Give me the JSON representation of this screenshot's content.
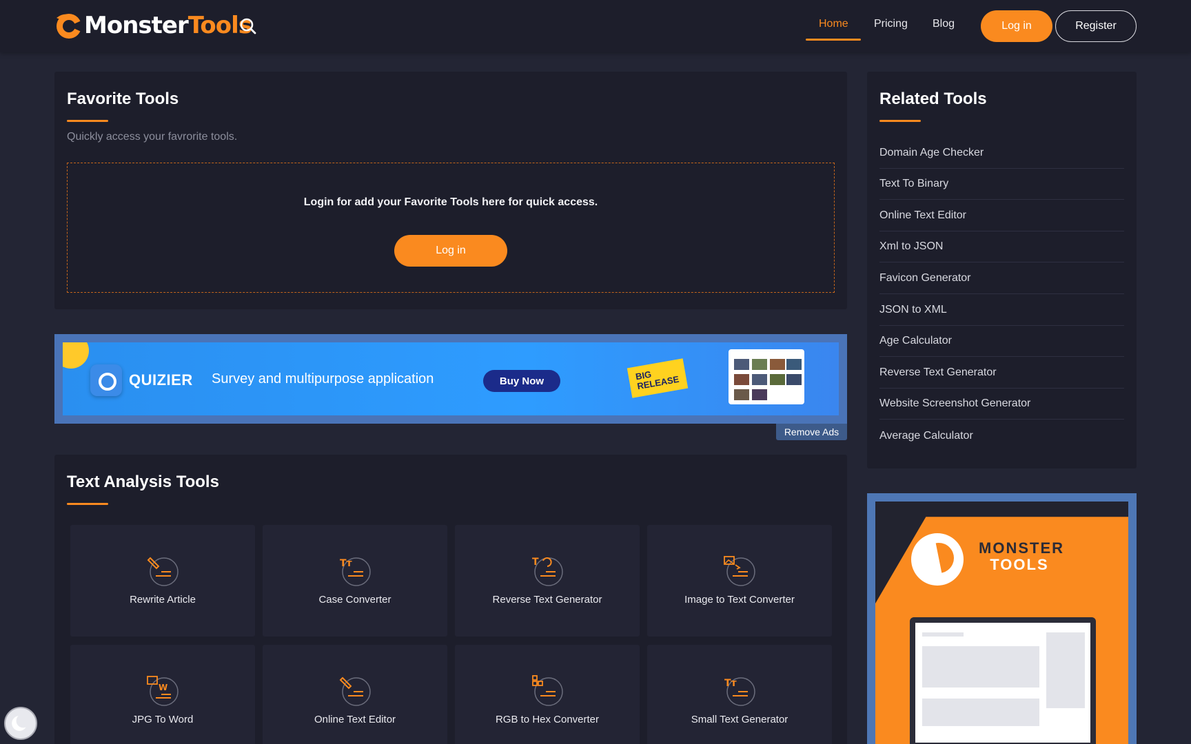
{
  "brand": {
    "logo_word_1": "Monster",
    "logo_word_2": "Tools",
    "accent": "#fa8a1f",
    "background": "#232534",
    "panel": "#1d1e2b"
  },
  "header": {
    "nav": [
      {
        "label": "Home",
        "active": true
      },
      {
        "label": "Pricing",
        "active": false
      },
      {
        "label": "Blog",
        "active": false
      }
    ],
    "login_label": "Log in",
    "register_label": "Register",
    "search_icon": "search-icon"
  },
  "favorites": {
    "title": "Favorite Tools",
    "subtitle": "Quickly access your favrorite tools.",
    "message": "Login for add your Favorite Tools here for quick access.",
    "login_label": "Log in"
  },
  "ad": {
    "brand": "QUIZIER",
    "tagline": "Survey and multipurpose application",
    "cta": "Buy Now",
    "badge": "BIG RELEASE",
    "remove_label": "Remove Ads"
  },
  "text_tools": {
    "title": "Text Analysis Tools",
    "items": [
      {
        "label": "Rewrite Article",
        "icon": "pencil-lines-icon"
      },
      {
        "label": "Case Converter",
        "icon": "text-case-icon"
      },
      {
        "label": "Reverse Text Generator",
        "icon": "text-reverse-icon"
      },
      {
        "label": "Image to Text Converter",
        "icon": "image-text-icon"
      },
      {
        "label": "JPG To Word",
        "icon": "image-word-icon"
      },
      {
        "label": "Online Text Editor",
        "icon": "pencil-lines-icon"
      },
      {
        "label": "RGB to Hex Converter",
        "icon": "color-blocks-icon"
      },
      {
        "label": "Small Text Generator",
        "icon": "text-case-icon"
      }
    ]
  },
  "related": {
    "title": "Related Tools",
    "items": [
      "Domain Age Checker",
      "Text To Binary",
      "Online Text Editor",
      "Xml to JSON",
      "Favicon Generator",
      "JSON to XML",
      "Age Calculator",
      "Reverse Text Generator",
      "Website Screenshot Generator",
      "Average Calculator"
    ]
  },
  "promo": {
    "line_1": "MONSTER",
    "line_2": "TOOLS"
  }
}
